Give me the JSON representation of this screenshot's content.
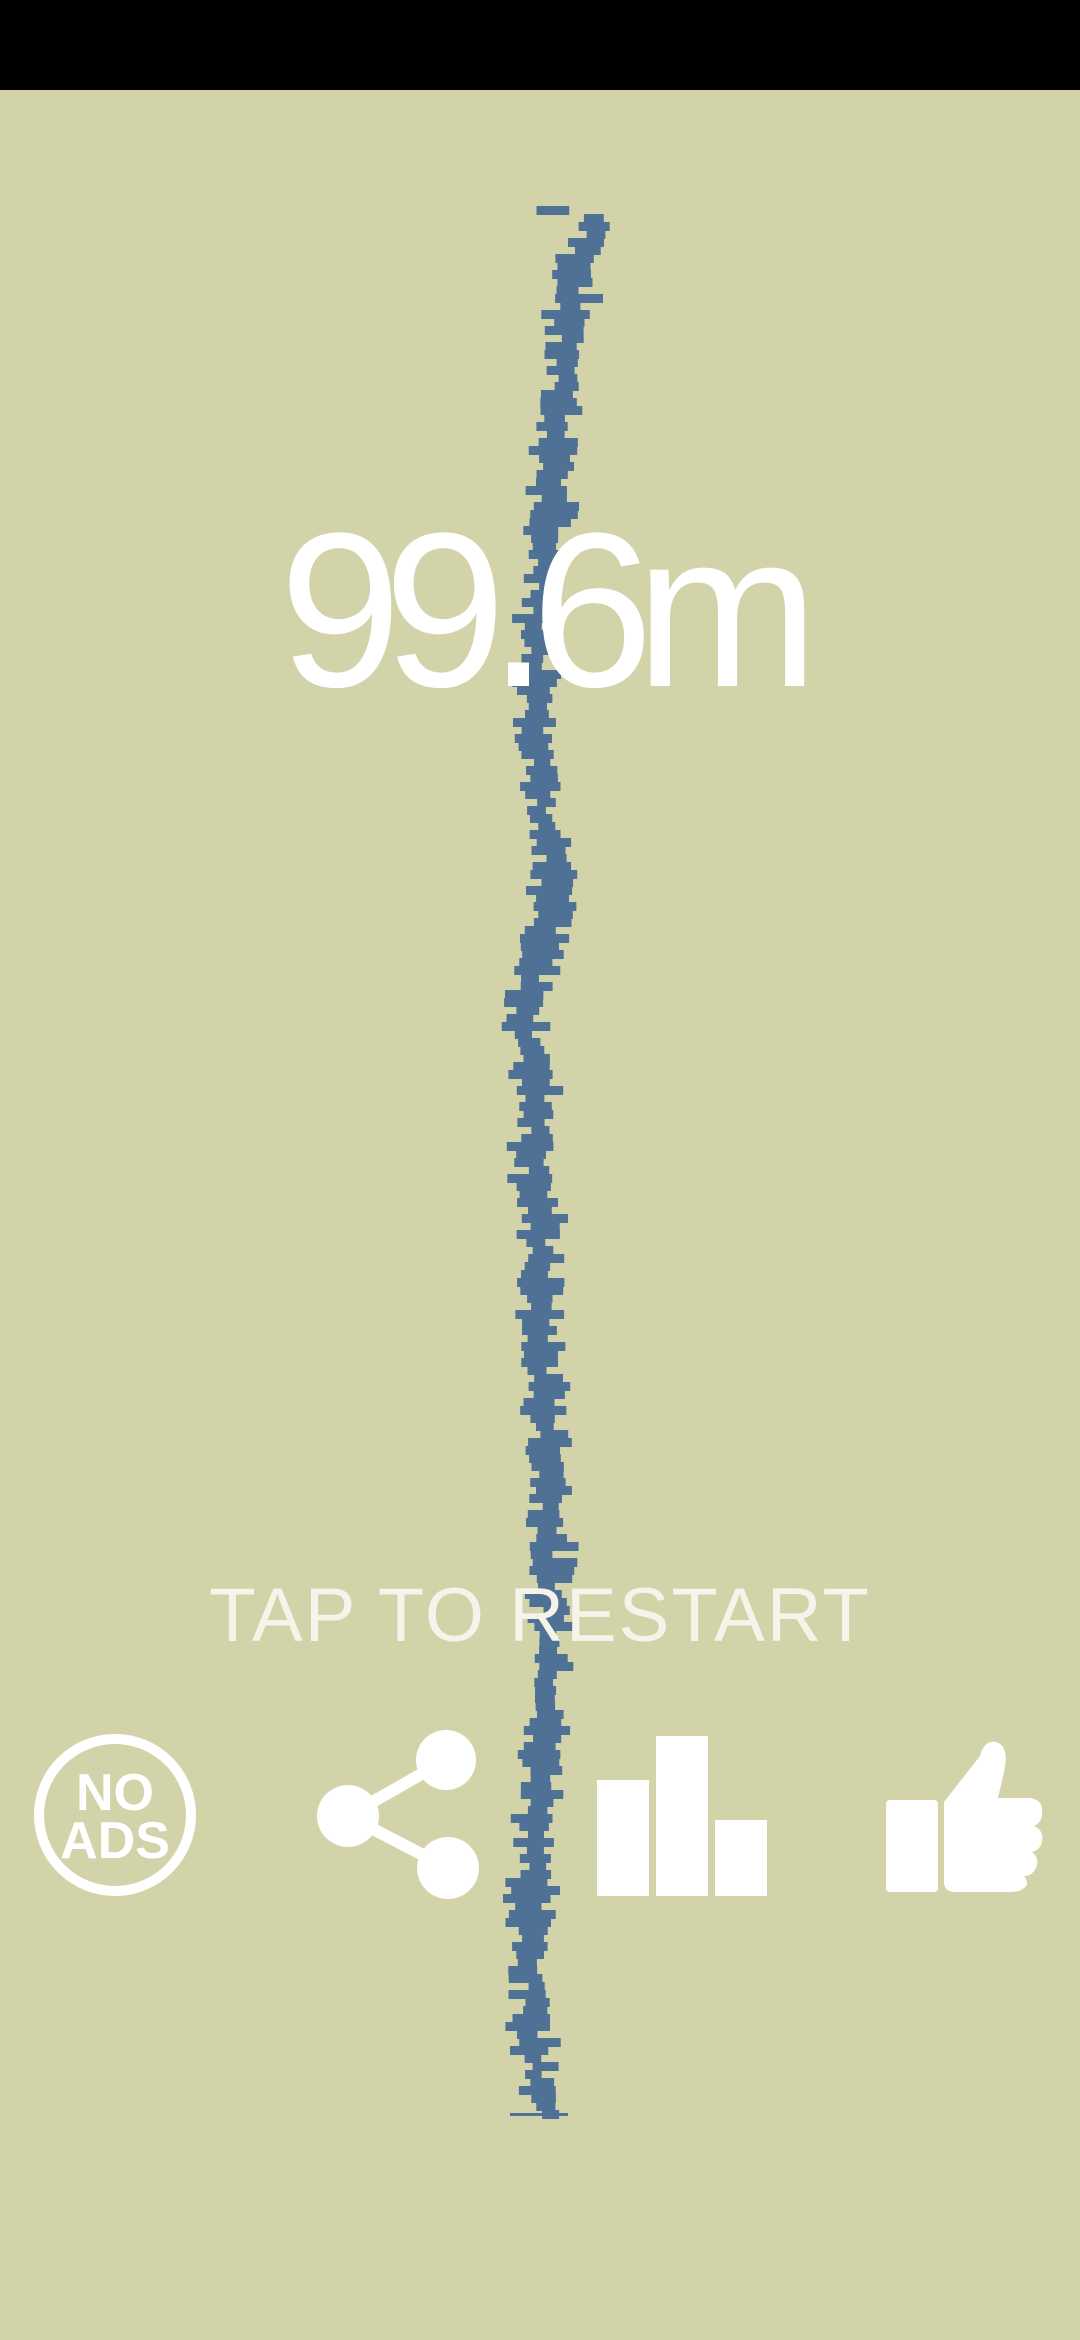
{
  "game": {
    "score_text": "99.6m",
    "restart_text": "TAP TO RESTART"
  },
  "buttons": {
    "no_ads_line1": "NO",
    "no_ads_line2": "ADS"
  },
  "icons": {
    "no_ads": "no-ads-icon",
    "share": "share-icon",
    "leaderboard": "leaderboard-icon",
    "rate": "thumbs-up-icon"
  },
  "colors": {
    "background": "#d3d3aa",
    "status_bar": "#000000",
    "tower_block": "#4f7196",
    "text": "#ffffff"
  }
}
